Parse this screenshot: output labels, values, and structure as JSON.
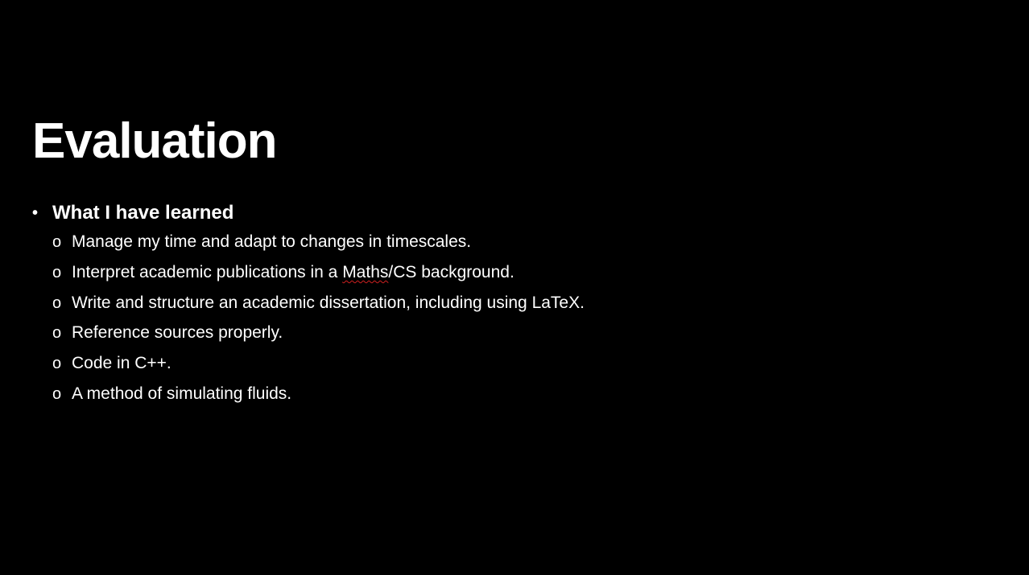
{
  "slide": {
    "title": "Evaluation",
    "bullet": {
      "marker": "•",
      "label": "What I have learned"
    },
    "sub_marker": "o",
    "items": [
      {
        "text": "Manage my time and adapt to changes in timescales."
      },
      {
        "before": "Interpret academic publications in a ",
        "flagged": "Maths",
        "after": "/CS background."
      },
      {
        "text": "Write and structure an academic dissertation, including using LaTeX."
      },
      {
        "text": "Reference sources properly."
      },
      {
        "text": "Code in C++."
      },
      {
        "text": "A method of simulating fluids."
      }
    ]
  },
  "colors": {
    "background": "#000000",
    "text": "#ffffff",
    "spellcheck_underline": "#d02020"
  }
}
